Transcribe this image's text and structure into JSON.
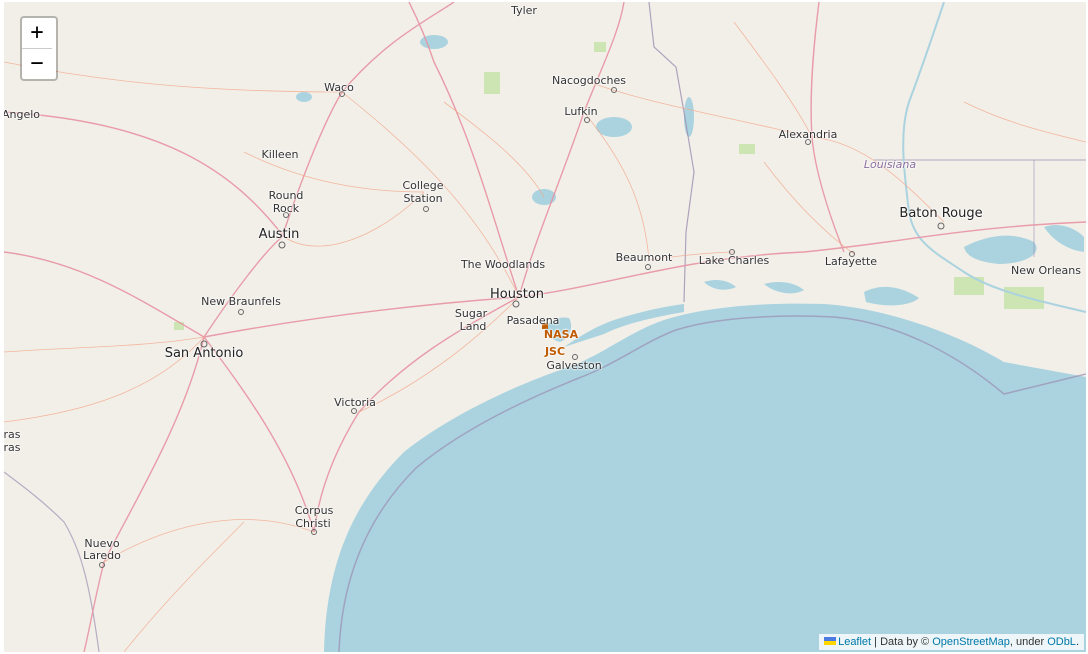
{
  "map": {
    "zoom_in_label": "+",
    "zoom_out_label": "−",
    "cities": {
      "tyler": "Tyler",
      "nacogdoches": "Nacogdoches",
      "lufkin": "Lufkin",
      "waco": "Waco",
      "angelo": "Angelo",
      "killeen": "Killeen",
      "alexandria": "Alexandria",
      "louisiana": "Louisiana",
      "round_rock_1": "Round",
      "round_rock_2": "Rock",
      "college_station_1": "College",
      "college_station_2": "Station",
      "baton_rouge": "Baton Rouge",
      "austin": "Austin",
      "the_woodlands": "The Woodlands",
      "beaumont": "Beaumont",
      "lake_charles": "Lake Charles",
      "lafayette": "Lafayette",
      "new_orleans": "New Orleans",
      "houston": "Houston",
      "new_braunfels": "New Braunfels",
      "sugar_land_1": "Sugar",
      "sugar_land_2": "Land",
      "pasadena": "Pasadena",
      "nasa": "NASA",
      "jsc": "JSC",
      "san_antonio": "San Antonio",
      "galveston": "Galveston",
      "victoria": "Victoria",
      "ras_1": "ras",
      "ras_2": "ras",
      "corpus_christi_1": "Corpus",
      "corpus_christi_2": "Christi",
      "nuevo_laredo_1": "Nuevo",
      "nuevo_laredo_2": "Laredo"
    },
    "attribution": {
      "leaflet": "Leaflet",
      "sep": " | Data by © ",
      "osm": "OpenStreetMap",
      "under": ", under ",
      "odbl": "ODbL",
      "end": "."
    },
    "colors": {
      "land": "#f2efe9",
      "water": "#aad3df",
      "road": "#f3a88a",
      "highway": "#e892a2",
      "boundary": "#9e8fb0"
    }
  }
}
